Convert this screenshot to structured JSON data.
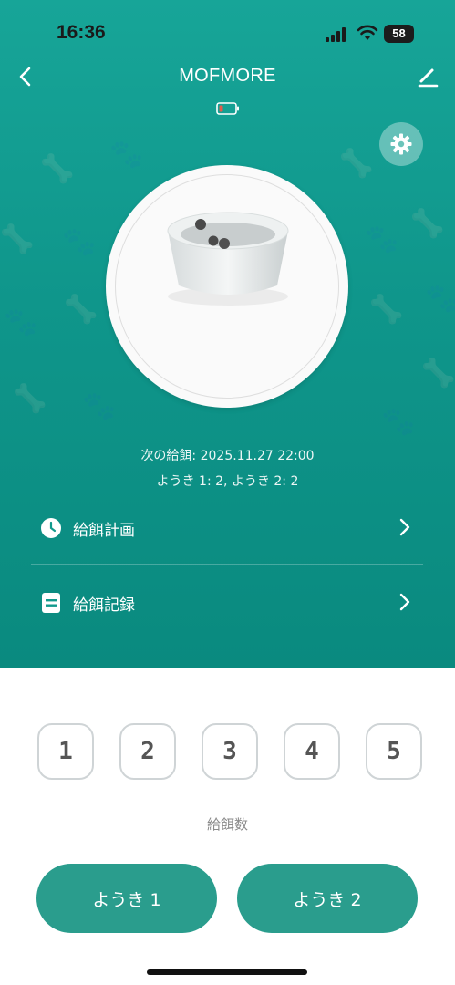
{
  "status_bar": {
    "time": "16:36",
    "battery_level": "58"
  },
  "header": {
    "title": "MOFMORE"
  },
  "device": {
    "battery_state": "low",
    "battery_color": "#e25b4b"
  },
  "next_feeding": {
    "text": "次の給餌: 2025.11.27 22:00",
    "portions": "ようき 1: 2, ようき 2: 2"
  },
  "menu": [
    {
      "label": "給餌計画",
      "icon": "clock-icon"
    },
    {
      "label": "給餌記録",
      "icon": "list-icon"
    }
  ],
  "portion_numbers": [
    "1",
    "2",
    "3",
    "4",
    "5"
  ],
  "portion_label": "給餌数",
  "actions": {
    "bowl_1": "ようき 1",
    "bowl_2": "ようき 2"
  },
  "colors": {
    "accent": "#12a093",
    "button": "#2a9d8d"
  }
}
